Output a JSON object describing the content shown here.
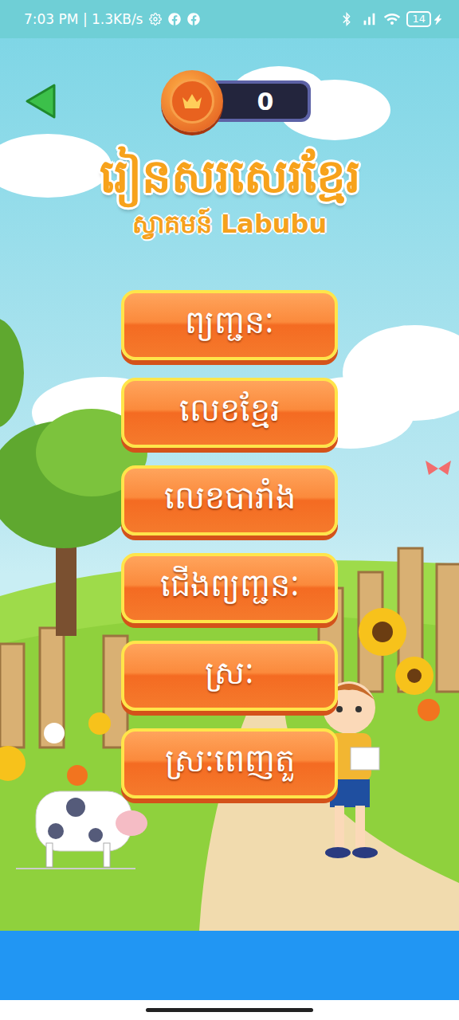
{
  "status_bar": {
    "time": "7:03 PM | 1.3KB/s",
    "battery": "14"
  },
  "score": "0",
  "title": "រៀនសរសេរខ្មែរ",
  "subtitle": "ស្វាគមន៍ Labubu",
  "menu": [
    "ព្យញ្ជនៈ",
    "លេខខ្មែរ",
    "លេខបារាំង",
    "ជើងព្យញ្ជនៈ",
    "ស្រៈ",
    "ស្រៈពេញតួ"
  ]
}
